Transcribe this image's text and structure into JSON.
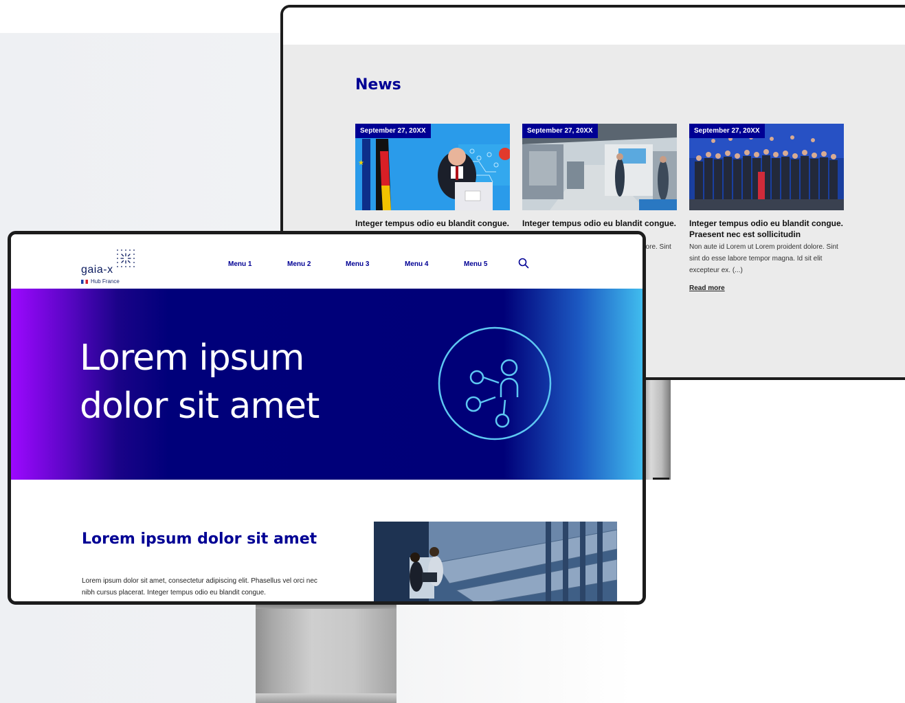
{
  "news": {
    "heading": "News",
    "cards": [
      {
        "date": "September 27, 20XX",
        "title": "Integer tempus odio eu blandit congue. Praesent nec est sollicitudin",
        "image": "speaker-at-podium-photo"
      },
      {
        "date": "September 27, 20XX",
        "title": "Integer tempus odio eu blandit congue. Praesent nec est sollicitudin",
        "text": "Non aute id Lorem ut Lorem proident dolore. Sint sint do esse labore tempor magna. Id sit",
        "image": "factory-hall-photo"
      },
      {
        "date": "September 27, 20XX",
        "title": "Integer tempus odio eu blandit congue. Praesent nec est sollicitudin",
        "text": "Non aute id Lorem ut Lorem proident dolore. Sint sint do esse labore tempor magna. Id sit elit excepteur ex. (...)",
        "link": "Read more",
        "image": "group-photo"
      }
    ]
  },
  "site": {
    "logo": "gaia-x",
    "logo_sub": "Hub France",
    "nav": [
      "Menu 1",
      "Menu 2",
      "Menu 3",
      "Menu 4",
      "Menu 5"
    ],
    "search_icon": "search-icon"
  },
  "hero": {
    "title": "Lorem ipsum\ndolor sit amet",
    "icon": "network-nodes-icon"
  },
  "section": {
    "title": "Lorem ipsum dolor sit amet",
    "text": "Lorem ipsum dolor sit amet, consectetur adipiscing elit. Phasellus vel orci nec nibh cursus placerat. Integer tempus odio eu blandit congue.",
    "image": "data-center-photo"
  },
  "colors": {
    "brand_blue": "#000094",
    "hero_gradient": [
      "#9d08ff",
      "#000078",
      "#40bcee"
    ],
    "hero_icon": "#5ec8f2",
    "news_background": "#ebebeb"
  }
}
